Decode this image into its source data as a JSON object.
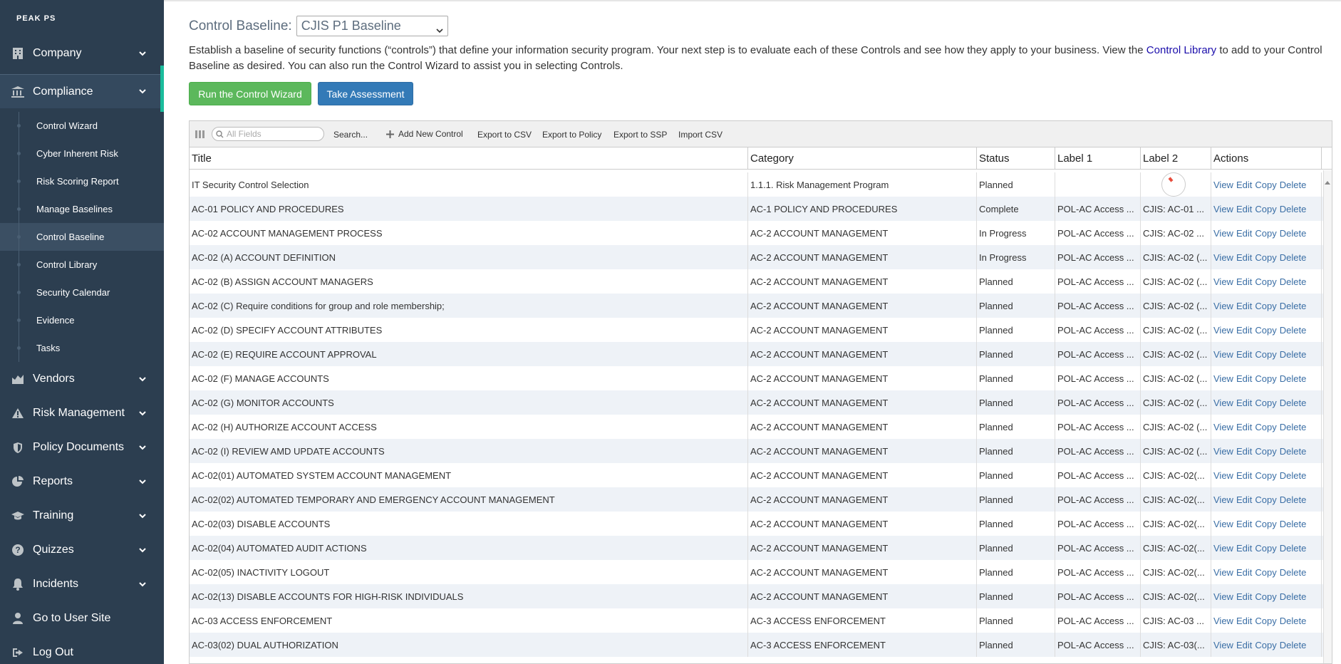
{
  "sidebar": {
    "brand": "PEAK PS",
    "items_top": [
      {
        "label": "Company",
        "icon": "building-icon"
      }
    ],
    "compliance": {
      "label": "Compliance",
      "icon": "bank-icon",
      "subitems": [
        "Control Wizard",
        "Cyber Inherent Risk",
        "Risk Scoring Report",
        "Manage Baselines",
        "Control Baseline",
        "Control Library",
        "Security Calendar",
        "Evidence",
        "Tasks"
      ],
      "active": "Control Baseline"
    },
    "items_bottom": [
      {
        "label": "Vendors",
        "icon": "chart-area-icon",
        "chevron": true
      },
      {
        "label": "Risk Management",
        "icon": "warning-icon",
        "chevron": true
      },
      {
        "label": "Policy Documents",
        "icon": "shield-icon",
        "chevron": true
      },
      {
        "label": "Reports",
        "icon": "pie-chart-icon",
        "chevron": true
      },
      {
        "label": "Training",
        "icon": "graduation-cap-icon",
        "chevron": true
      },
      {
        "label": "Quizzes",
        "icon": "question-circle-icon",
        "chevron": true
      },
      {
        "label": "Incidents",
        "icon": "bell-icon",
        "chevron": true
      },
      {
        "label": "Go to User Site",
        "icon": "user-icon",
        "chevron": false
      },
      {
        "label": "Log Out",
        "icon": "sign-out-icon",
        "chevron": false
      }
    ]
  },
  "baseline": {
    "label": "Control Baseline:",
    "selected": "CJIS P1 Baseline"
  },
  "intro": {
    "part1": "Establish a baseline of security functions (“controls”) that define your information security program. Your next step is to evaluate each of these Controls and see how they apply to your business. View the ",
    "link": "Control Library",
    "part2": " to add to your Control Baseline as desired. You can also run the Control Wizard to assist you in selecting Controls."
  },
  "buttons": {
    "wizard": "Run the Control Wizard",
    "assessment": "Take Assessment"
  },
  "toolbar": {
    "search_placeholder": "All Fields",
    "search": "Search...",
    "add": "Add New Control",
    "export_csv": "Export to CSV",
    "export_policy": "Export to Policy",
    "export_ssp": "Export to SSP",
    "import_csv": "Import CSV"
  },
  "table": {
    "headers": [
      "Title",
      "Category",
      "Status",
      "Label 1",
      "Label 2",
      "Actions"
    ],
    "actions": [
      "View",
      "Edit",
      "Copy",
      "Delete"
    ],
    "rows": [
      [
        "IT Security Control Selection",
        "1.1.1. Risk Management Program",
        "Planned",
        "",
        ""
      ],
      [
        "AC-01 POLICY AND PROCEDURES",
        "AC-1 POLICY AND PROCEDURES",
        "Complete",
        "POL-AC Access ...",
        "CJIS: AC-01 ..."
      ],
      [
        "AC-02 ACCOUNT MANAGEMENT PROCESS",
        "AC-2 ACCOUNT MANAGEMENT",
        "In Progress",
        "POL-AC Access ...",
        "CJIS: AC-02 ..."
      ],
      [
        "AC-02 (A) ACCOUNT DEFINITION",
        "AC-2 ACCOUNT MANAGEMENT",
        "In Progress",
        "POL-AC Access ...",
        "CJIS: AC-02 (..."
      ],
      [
        "AC-02 (B) ASSIGN ACCOUNT MANAGERS",
        "AC-2 ACCOUNT MANAGEMENT",
        "Planned",
        "POL-AC Access ...",
        "CJIS: AC-02 (..."
      ],
      [
        "AC-02 (C) Require conditions for group and role membership;",
        "AC-2 ACCOUNT MANAGEMENT",
        "Planned",
        "POL-AC Access ...",
        "CJIS: AC-02 (..."
      ],
      [
        "AC-02 (D) SPECIFY ACCOUNT ATTRIBUTES",
        "AC-2 ACCOUNT MANAGEMENT",
        "Planned",
        "POL-AC Access ...",
        "CJIS: AC-02 (..."
      ],
      [
        "AC-02 (E) REQUIRE ACCOUNT APPROVAL",
        "AC-2 ACCOUNT MANAGEMENT",
        "Planned",
        "POL-AC Access ...",
        "CJIS: AC-02 (..."
      ],
      [
        "AC-02 (F) MANAGE ACCOUNTS",
        "AC-2 ACCOUNT MANAGEMENT",
        "Planned",
        "POL-AC Access ...",
        "CJIS: AC-02 (..."
      ],
      [
        "AC-02 (G) MONITOR ACCOUNTS",
        "AC-2 ACCOUNT MANAGEMENT",
        "Planned",
        "POL-AC Access ...",
        "CJIS: AC-02 (..."
      ],
      [
        "AC-02 (H) AUTHORIZE ACCOUNT ACCESS",
        "AC-2 ACCOUNT MANAGEMENT",
        "Planned",
        "POL-AC Access ...",
        "CJIS: AC-02 (..."
      ],
      [
        "AC-02 (I) REVIEW AMD UPDATE ACCOUNTS",
        "AC-2 ACCOUNT MANAGEMENT",
        "Planned",
        "POL-AC Access ...",
        "CJIS: AC-02 (..."
      ],
      [
        "AC-02(01) AUTOMATED SYSTEM ACCOUNT MANAGEMENT",
        "AC-2 ACCOUNT MANAGEMENT",
        "Planned",
        "POL-AC Access ...",
        "CJIS: AC-02(..."
      ],
      [
        "AC-02(02) AUTOMATED TEMPORARY AND EMERGENCY ACCOUNT MANAGEMENT",
        "AC-2 ACCOUNT MANAGEMENT",
        "Planned",
        "POL-AC Access ...",
        "CJIS: AC-02(..."
      ],
      [
        "AC-02(03) DISABLE ACCOUNTS",
        "AC-2 ACCOUNT MANAGEMENT",
        "Planned",
        "POL-AC Access ...",
        "CJIS: AC-02(..."
      ],
      [
        "AC-02(04) AUTOMATED AUDIT ACTIONS",
        "AC-2 ACCOUNT MANAGEMENT",
        "Planned",
        "POL-AC Access ...",
        "CJIS: AC-02(..."
      ],
      [
        "AC-02(05) INACTIVITY LOGOUT",
        "AC-2 ACCOUNT MANAGEMENT",
        "Planned",
        "POL-AC Access ...",
        "CJIS: AC-02(..."
      ],
      [
        "AC-02(13) DISABLE ACCOUNTS FOR HIGH-RISK INDIVIDUALS",
        "AC-2 ACCOUNT MANAGEMENT",
        "Planned",
        "POL-AC Access ...",
        "CJIS: AC-02(..."
      ],
      [
        "AC-03 ACCESS ENFORCEMENT",
        "AC-3 ACCESS ENFORCEMENT",
        "Planned",
        "POL-AC Access ...",
        "CJIS: AC-03 ..."
      ],
      [
        "AC-03(02) DUAL AUTHORIZATION",
        "AC-3 ACCESS ENFORCEMENT",
        "Planned",
        "POL-AC Access ...",
        "CJIS: AC-03(..."
      ]
    ]
  },
  "colors": {
    "sidebar_bg": "#2c3e50",
    "accent": "#1abc9c",
    "green_button": "#5cb85c",
    "blue_button": "#337ab7",
    "link": "#3a6ea5"
  }
}
